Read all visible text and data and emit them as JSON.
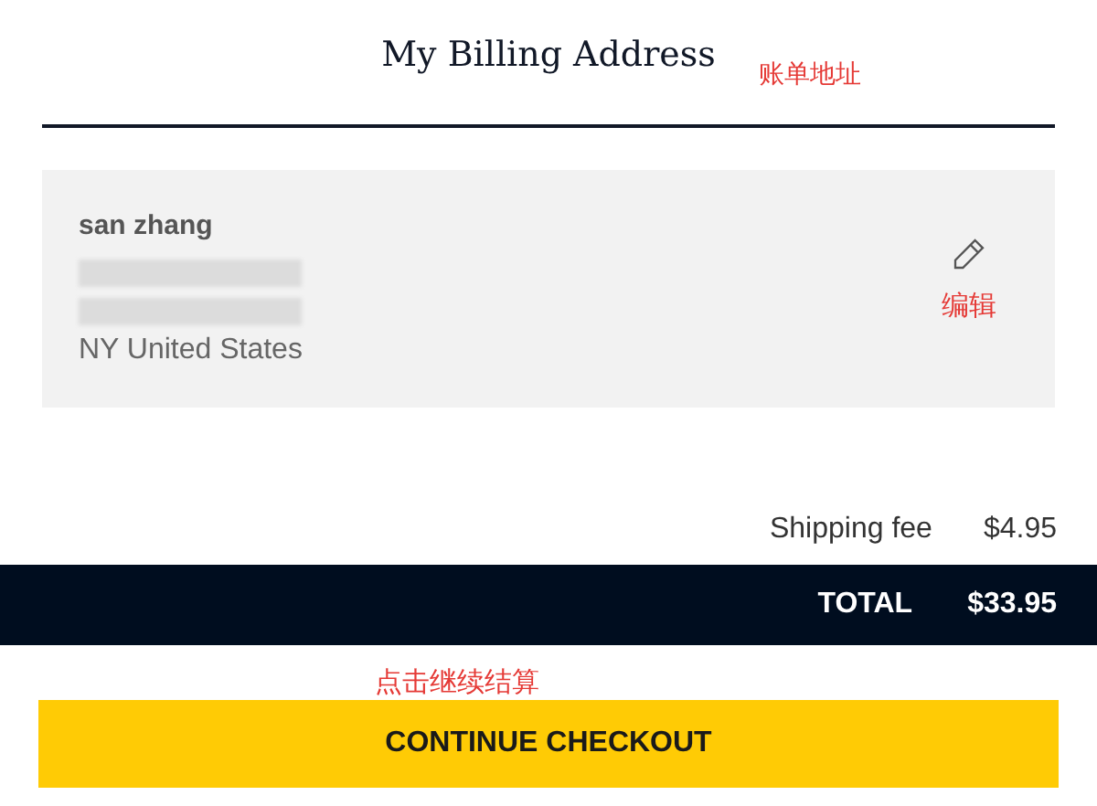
{
  "title": "My Billing Address",
  "title_note": "账单地址",
  "address": {
    "name": "san zhang",
    "lines": [
      {
        "kind": "redacted"
      },
      {
        "kind": "redacted"
      },
      {
        "kind": "text",
        "text": "NY United States"
      }
    ],
    "edit_note": "编辑"
  },
  "shipping": {
    "label": "Shipping fee",
    "value": "$4.95"
  },
  "total": {
    "label": "TOTAL",
    "value": "$33.95"
  },
  "checkout_note": "点击继续结算",
  "checkout_button": "CONTINUE CHECKOUT"
}
